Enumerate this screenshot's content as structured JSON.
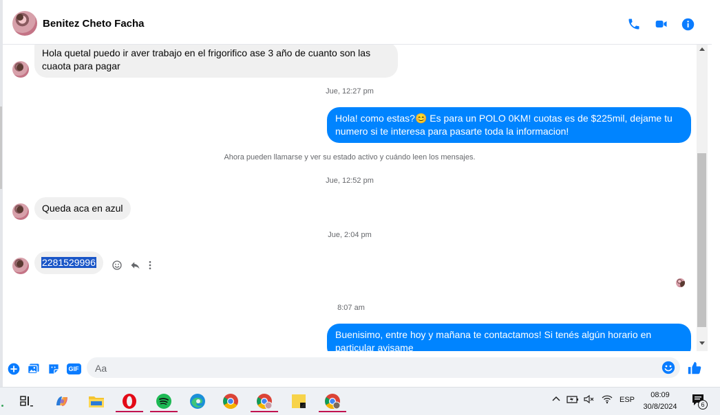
{
  "contact": {
    "name": "Benitez Cheto Facha"
  },
  "header_icons": [
    "phone-icon",
    "video-camera-icon",
    "info-icon"
  ],
  "messages": [
    {
      "dir": "in",
      "text": "Hola quetal puedo ir aver trabajo en el frigorifico ase 3 año de cuanto son las cuaota para pagar"
    },
    {
      "dir": "out",
      "text": "Hola! como estas?😊 Es para un POLO 0KM! cuotas es de $225mil, dejame tu numero si te interesa para pasarte toda la informacion!"
    },
    {
      "dir": "in",
      "text": "Queda aca en azul"
    },
    {
      "dir": "in",
      "text": "2281529996"
    },
    {
      "dir": "out",
      "text": "Buenisimo, entre hoy y mañana te contactamos! Si tenés algún horario en particular avisame"
    }
  ],
  "timestamps": [
    "Jue, 12:27 pm",
    "Jue, 12:52 pm",
    "Jue, 2:04 pm",
    "8:07 am"
  ],
  "system_notice": "Ahora pueden llamarse y ver su estado activo y cuándo leen los mensajes.",
  "composer": {
    "placeholder": "Aa",
    "gif_label": "GIF"
  },
  "taskbar": {
    "apps": [
      "task-view",
      "copilot",
      "file-explorer",
      "opera",
      "spotify",
      "edge",
      "chrome",
      "chrome-profile",
      "sticky-notes",
      "chrome-profile-2"
    ],
    "tray": {
      "language": "ESP",
      "time": "08:09",
      "date": "30/8/2024",
      "notifications": "6"
    }
  },
  "colors": {
    "accent": "#0084ff",
    "bubble_in": "#f0f0f0",
    "icon_blue": "#0a7cff"
  }
}
